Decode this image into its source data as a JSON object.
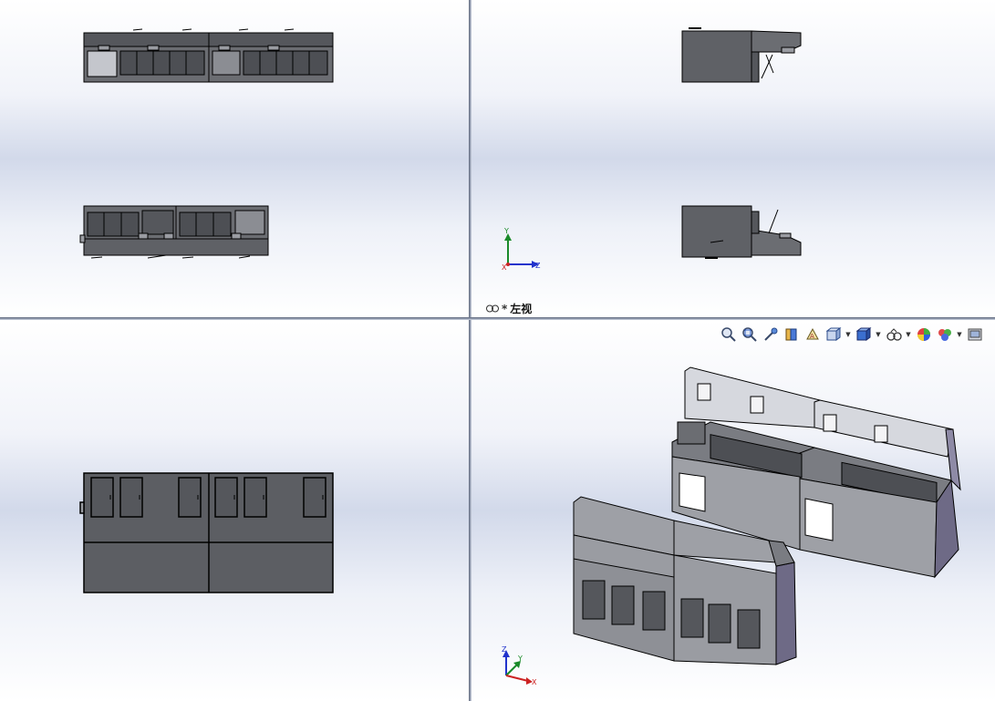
{
  "viewports": {
    "top_left": {
      "name": "top-view"
    },
    "top_right": {
      "name": "left-view",
      "label_prefix": "*",
      "label": "左视"
    },
    "bottom_left": {
      "name": "front-view"
    },
    "bottom_right": {
      "name": "isometric-view"
    }
  },
  "triad": {
    "x": "X",
    "y": "Y",
    "z": "Z"
  },
  "toolbar": [
    {
      "icon": "zoom-to-fit-icon"
    },
    {
      "icon": "zoom-to-area-icon"
    },
    {
      "icon": "previous-view-icon"
    },
    {
      "icon": "section-view-icon"
    },
    {
      "icon": "dynamic-annotation-views-icon"
    },
    {
      "icon": "view-orientation-icon",
      "dropdown": true
    },
    {
      "icon": "display-style-icon",
      "dropdown": true
    },
    {
      "icon": "hide-show-items-icon",
      "dropdown": true
    },
    {
      "icon": "edit-appearance-icon"
    },
    {
      "icon": "apply-scene-icon",
      "dropdown": true
    },
    {
      "icon": "view-settings-icon"
    }
  ],
  "colors": {
    "part_face": "#5f6166",
    "part_face_light": "#8b8d93",
    "edge": "#000000",
    "viewport_bg_mid": "#d2d9ea",
    "divider": "#8e97ab"
  }
}
